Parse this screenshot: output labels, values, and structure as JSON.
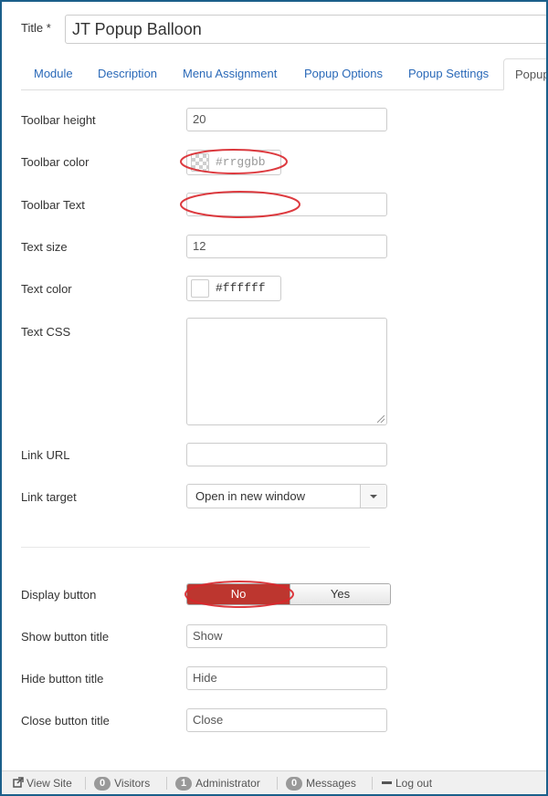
{
  "title_field": {
    "label": "Title *",
    "value": "JT Popup Balloon"
  },
  "tabs": [
    {
      "label": "Module"
    },
    {
      "label": "Description"
    },
    {
      "label": "Menu Assignment"
    },
    {
      "label": "Popup Options"
    },
    {
      "label": "Popup Settings"
    },
    {
      "label": "Popup"
    }
  ],
  "form": {
    "toolbar_height": {
      "label": "Toolbar height",
      "value": "20"
    },
    "toolbar_color": {
      "label": "Toolbar color",
      "placeholder": "#rrggbb"
    },
    "toolbar_text": {
      "label": "Toolbar Text",
      "value": ""
    },
    "text_size": {
      "label": "Text size",
      "value": "12"
    },
    "text_color": {
      "label": "Text color",
      "value": "#ffffff",
      "swatch": "#ffffff"
    },
    "text_css": {
      "label": "Text CSS",
      "value": ""
    },
    "link_url": {
      "label": "Link URL",
      "value": ""
    },
    "link_target": {
      "label": "Link target",
      "selected": "Open in new window"
    },
    "display_button": {
      "label": "Display button",
      "no_label": "No",
      "yes_label": "Yes",
      "selected": "No"
    },
    "show_button_title": {
      "label": "Show button title",
      "value": "Show"
    },
    "hide_button_title": {
      "label": "Hide button title",
      "value": "Hide"
    },
    "close_button_title": {
      "label": "Close button title",
      "value": "Close"
    }
  },
  "statusbar": {
    "view_site": "View Site",
    "visitors_count": "0",
    "visitors_label": "Visitors",
    "admin_count": "1",
    "admin_label": "Administrator",
    "messages_count": "0",
    "messages_label": "Messages",
    "logout": "Log out"
  },
  "colors": {
    "tab_link": "#2a69b8",
    "toggle_no": "#bd362f",
    "annotation": "#d9262b",
    "frame": "#1b5f8a"
  }
}
